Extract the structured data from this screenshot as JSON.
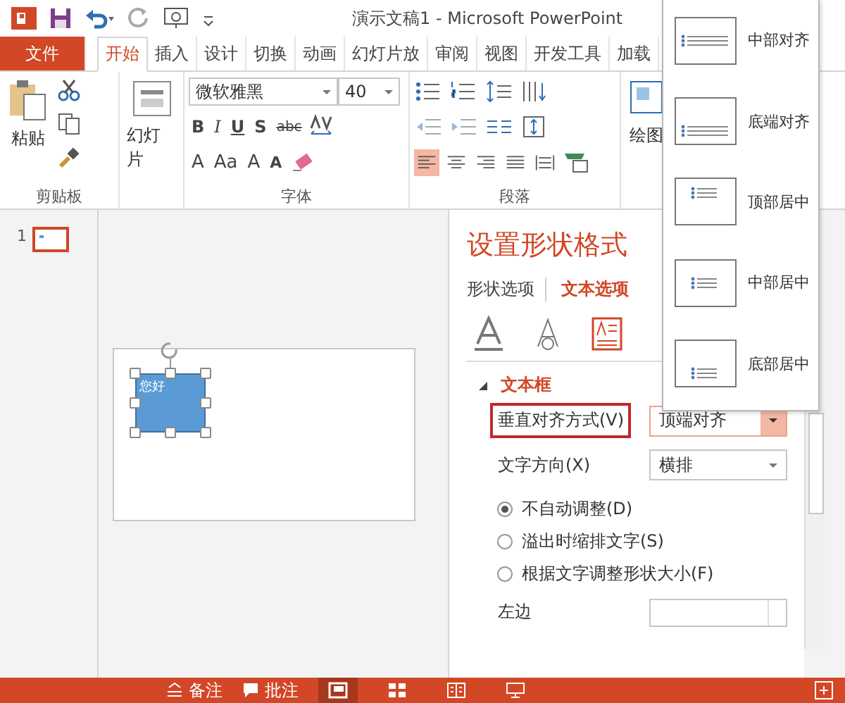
{
  "title_bar": {
    "title": "演示文稿1 - Microsoft PowerPoint"
  },
  "ribbon_tabs": [
    {
      "label": "文件",
      "kind": "file",
      "selected": false
    },
    {
      "label": "开始",
      "kind": "tab",
      "selected": true
    },
    {
      "label": "插入",
      "kind": "tab",
      "selected": false
    },
    {
      "label": "设计",
      "kind": "tab",
      "selected": false
    },
    {
      "label": "切换",
      "kind": "tab",
      "selected": false
    },
    {
      "label": "动画",
      "kind": "tab",
      "selected": false
    },
    {
      "label": "幻灯片放",
      "kind": "tab",
      "selected": false
    },
    {
      "label": "审阅",
      "kind": "tab",
      "selected": false
    },
    {
      "label": "视图",
      "kind": "tab",
      "selected": false
    },
    {
      "label": "开发工具",
      "kind": "tab",
      "selected": false
    },
    {
      "label": "加载",
      "kind": "tab",
      "selected": false
    }
  ],
  "ribbon": {
    "clipboard": {
      "paste": "粘贴",
      "label": "剪贴板"
    },
    "slides": {
      "new_slide": "幻灯片"
    },
    "font": {
      "family": "微软雅黑",
      "size": "40",
      "format_buttons": [
        "B",
        "I",
        "U",
        "S",
        "abc"
      ],
      "color_button": "A",
      "case_button": "Aa",
      "grow": "A",
      "shrink": "A",
      "label": "字体"
    },
    "paragraph": {
      "align_buttons": [
        {
          "selected": true
        },
        {
          "selected": false
        },
        {
          "selected": false
        },
        {
          "selected": false
        },
        {
          "selected": false
        }
      ],
      "label": "段落"
    },
    "drawing": {
      "label": "绘图"
    }
  },
  "thumbnail": {
    "number": "1",
    "selected": true
  },
  "slide": {
    "shape": {
      "text": "您好",
      "selected": true
    }
  },
  "format_pane": {
    "title": "设置形状格式",
    "tabs": [
      {
        "label": "形状选项",
        "selected": false
      },
      {
        "label": "文本选项",
        "selected": true
      }
    ],
    "icon_tabs": [
      {
        "kind": "fill",
        "selected": false
      },
      {
        "kind": "outline",
        "selected": false
      },
      {
        "kind": "textbox",
        "selected": true
      }
    ],
    "section": {
      "title": "文本框",
      "expanded": true
    },
    "vertical_align": {
      "label": "垂直对齐方式(V)",
      "value": "顶端对齐",
      "open": true
    },
    "text_direction": {
      "label": "文字方向(X)",
      "value": "横排"
    },
    "autofit": [
      {
        "label": "不自动调整(D)",
        "selected": true
      },
      {
        "label": "溢出时缩排文字(S)",
        "selected": false
      },
      {
        "label": "根据文字调整形状大小(F)",
        "selected": false
      }
    ],
    "left_margin": {
      "label": "左边"
    }
  },
  "dropdown": [
    {
      "label": "中部对齐",
      "kind": "middle"
    },
    {
      "label": "底端对齐",
      "kind": "bottom"
    },
    {
      "label": "顶部居中",
      "kind": "top-centered"
    },
    {
      "label": "中部居中",
      "kind": "middle-centered"
    },
    {
      "label": "底部居中",
      "kind": "bottom-centered"
    }
  ],
  "status_bar": {
    "notes": "备注",
    "comments": "批注",
    "views": [
      {
        "kind": "normal",
        "selected": true
      },
      {
        "kind": "sorter",
        "selected": false
      },
      {
        "kind": "reading",
        "selected": false
      },
      {
        "kind": "slideshow",
        "selected": false
      }
    ]
  }
}
